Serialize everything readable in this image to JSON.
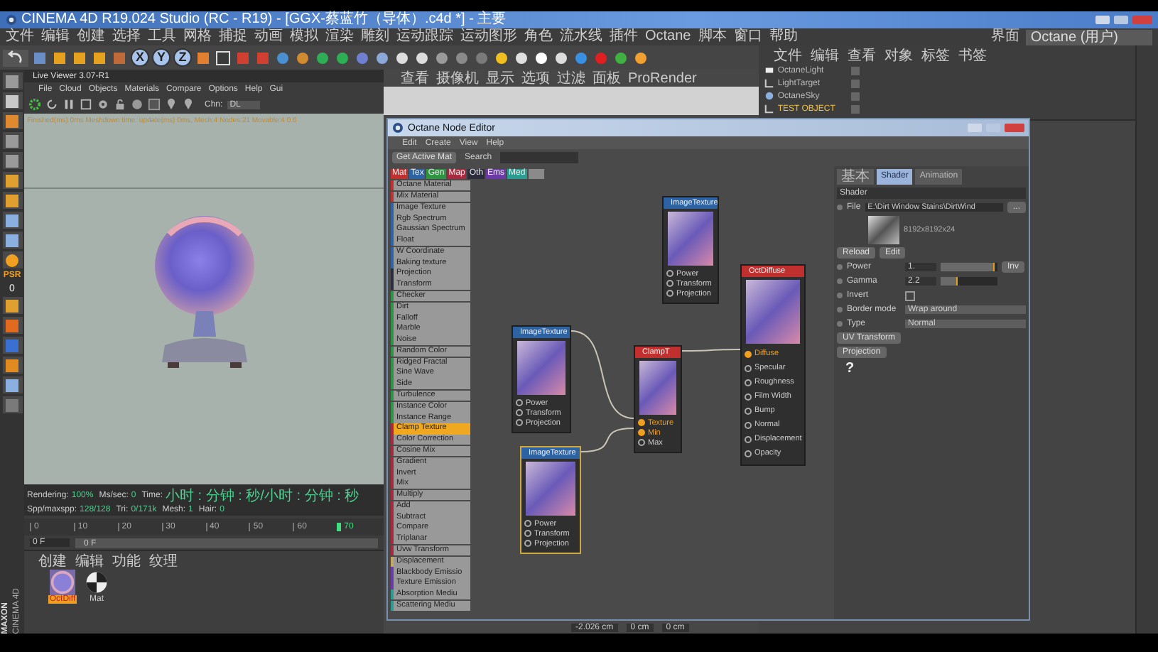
{
  "window": {
    "title": "CINEMA 4D R19.024 Studio (RC - R19) - [GGX-蔡蓝竹（导体）.c4d *] - 主要",
    "menus": [
      "文件",
      "编辑",
      "创建",
      "选择",
      "工具",
      "网格",
      "捕捉",
      "动画",
      "模拟",
      "渲染",
      "雕刻",
      "运动跟踪",
      "运动图形",
      "角色",
      "流水线",
      "插件",
      "Octane",
      "脚本",
      "窗口",
      "帮助"
    ],
    "layout_label": "界面",
    "layout_value": "Octane (用户)"
  },
  "toolbar": {
    "axis_buttons": [
      {
        "label": "X",
        "selected": true
      },
      {
        "label": "Y",
        "selected": true
      },
      {
        "label": "Z",
        "selected": true
      }
    ]
  },
  "left_toolbar": {
    "psr_label": "PSR",
    "psr_value": "0"
  },
  "live_viewer": {
    "title": "Live Viewer 3.07-R1",
    "menus": [
      "File",
      "Cloud",
      "Objects",
      "Materials",
      "Compare",
      "Options",
      "Help",
      "Gui"
    ],
    "chn_label": "Chn:",
    "chn_value": "DL",
    "status_text": "Finished(ms) 0ms Meshdown time: update(ms) 0ms, Mesh:4 Nodes:21 Movable:4 0.0",
    "stats": [
      {
        "label": "Rendering:",
        "value": "100%"
      },
      {
        "label": "Ms/sec:",
        "value": "0"
      },
      {
        "label": "Time:",
        "value": "小时 : 分钟 : 秒/小时 : 分钟 : 秒"
      },
      {
        "label": "Spp/maxspp:",
        "value": "128/128"
      },
      {
        "label": "Tri:",
        "value": "0/171k"
      },
      {
        "label": "Mesh:",
        "value": "1"
      },
      {
        "label": "Hair:",
        "value": "0"
      }
    ]
  },
  "timeline": {
    "ticks": [
      {
        "label": "0",
        "current": false
      },
      {
        "label": "10",
        "current": false
      },
      {
        "label": "20",
        "current": false
      },
      {
        "label": "30",
        "current": false
      },
      {
        "label": "40",
        "current": false
      },
      {
        "label": "50",
        "current": false
      },
      {
        "label": "60",
        "current": false
      },
      {
        "label": "70",
        "current": true
      }
    ],
    "frame_value": "0 F",
    "range": {
      "start": "0 F",
      "level": 1
    }
  },
  "material_manager": {
    "menus": [
      "创建",
      "编辑",
      "功能",
      "纹理"
    ],
    "materials": [
      {
        "name": "OctDiff",
        "kind": "texture",
        "selected": true
      },
      {
        "name": "Mat",
        "kind": "checker",
        "selected": false
      }
    ]
  },
  "brand": {
    "maxon": "MAXON",
    "product": "CINEMA 4D"
  },
  "viewport": {
    "menus": [
      "查看",
      "摄像机",
      "显示",
      "选项",
      "过滤",
      "面板",
      "ProRender"
    ],
    "coordinates": [
      "-2.026 cm",
      "0 cm",
      "0 cm"
    ]
  },
  "object_manager": {
    "menus": [
      "文件",
      "编辑",
      "查看",
      "对象",
      "标签",
      "书签"
    ],
    "objects": [
      {
        "name": "OctaneLight",
        "kind": "light",
        "selected": false
      },
      {
        "name": "LightTarget",
        "kind": "target",
        "selected": false
      },
      {
        "name": "OctaneSky",
        "kind": "sky",
        "selected": false
      },
      {
        "name": "TEST OBJECT",
        "kind": "target",
        "selected": true
      }
    ]
  },
  "node_editor": {
    "title": "Octane Node Editor",
    "menus": [
      "Edit",
      "Create",
      "View",
      "Help"
    ],
    "get_active_button": "Get Active Mat",
    "search_label": "Search",
    "categories": [
      {
        "label": "Mat",
        "color": "#c0302f"
      },
      {
        "label": "Tex",
        "color": "#2d63a3"
      },
      {
        "label": "Gen",
        "color": "#2f9442"
      },
      {
        "label": "Map",
        "color": "#a8283e"
      },
      {
        "label": "Oth",
        "color": "#2b2d3d"
      },
      {
        "label": "Ems",
        "color": "#6b3aa6"
      },
      {
        "label": "Med",
        "color": "#2a9c92"
      }
    ],
    "node_list": [
      {
        "name": "Octane Material",
        "color": "#c0302f",
        "selected": false
      },
      {
        "name": "Mix Material",
        "color": "#c0302f",
        "selected": false
      },
      {
        "name": "Image Texture",
        "color": "#2d63a3",
        "selected": false
      },
      {
        "name": "Rgb Spectrum",
        "color": "#2d63a3",
        "selected": false
      },
      {
        "name": "Gaussian Spectrum",
        "color": "#2d63a3",
        "selected": false
      },
      {
        "name": "Float",
        "color": "#2d63a3",
        "selected": false
      },
      {
        "name": "W Coordinate",
        "color": "#2d63a3",
        "selected": false
      },
      {
        "name": "Baking texture",
        "color": "#2d63a3",
        "selected": false
      },
      {
        "name": "Projection",
        "color": "#2b2d3d",
        "selected": false
      },
      {
        "name": "Transform",
        "color": "#2b2d3d",
        "selected": false
      },
      {
        "name": "Checker",
        "color": "#2f9442",
        "selected": false
      },
      {
        "name": "Dirt",
        "color": "#2f9442",
        "selected": false
      },
      {
        "name": "Falloff",
        "color": "#2f9442",
        "selected": false
      },
      {
        "name": "Marble",
        "color": "#2f9442",
        "selected": false
      },
      {
        "name": "Noise",
        "color": "#2f9442",
        "selected": false
      },
      {
        "name": "Random Color",
        "color": "#2f9442",
        "selected": false
      },
      {
        "name": "Ridged Fractal",
        "color": "#2f9442",
        "selected": false
      },
      {
        "name": "Sine Wave",
        "color": "#2f9442",
        "selected": false
      },
      {
        "name": "Side",
        "color": "#2f9442",
        "selected": false
      },
      {
        "name": "Turbulence",
        "color": "#2f9442",
        "selected": false
      },
      {
        "name": "Instance Color",
        "color": "#2f9442",
        "selected": false
      },
      {
        "name": "Instance Range",
        "color": "#2f9442",
        "selected": false
      },
      {
        "name": "Clamp Texture",
        "color": "#a8283e",
        "selected": true
      },
      {
        "name": "Color Correction",
        "color": "#a8283e",
        "selected": false
      },
      {
        "name": "Cosine Mix",
        "color": "#a8283e",
        "selected": false
      },
      {
        "name": "Gradient",
        "color": "#a8283e",
        "selected": false
      },
      {
        "name": "Invert",
        "color": "#a8283e",
        "selected": false
      },
      {
        "name": "Mix",
        "color": "#a8283e",
        "selected": false
      },
      {
        "name": "Multiply",
        "color": "#a8283e",
        "selected": false
      },
      {
        "name": "Add",
        "color": "#a8283e",
        "selected": false
      },
      {
        "name": "Subtract",
        "color": "#a8283e",
        "selected": false
      },
      {
        "name": "Compare",
        "color": "#a8283e",
        "selected": false
      },
      {
        "name": "Triplanar",
        "color": "#a8283e",
        "selected": false
      },
      {
        "name": "Uvw Transform",
        "color": "#a8283e",
        "selected": false
      },
      {
        "name": "Displacement",
        "color": "#c8a860",
        "selected": false
      },
      {
        "name": "Blackbody Emissio",
        "color": "#6b3aa6",
        "selected": false
      },
      {
        "name": "Texture Emission",
        "color": "#6b3aa6",
        "selected": false
      },
      {
        "name": "Absorption Mediu",
        "color": "#2a9c92",
        "selected": false
      },
      {
        "name": "Scattering Mediu",
        "color": "#2a9c92",
        "selected": false
      }
    ],
    "nodes": [
      {
        "title": "ImageTexture",
        "kind": "texture",
        "color": "#2d63a3",
        "selected": false,
        "ports": [
          {
            "name": "Power",
            "connected": false
          },
          {
            "name": "Transform",
            "connected": false
          },
          {
            "name": "Projection",
            "connected": false
          }
        ]
      },
      {
        "title": "OctDiffuse",
        "kind": "material",
        "color": "#c0302f",
        "selected": false,
        "ports": [
          {
            "name": "Diffuse",
            "connected": true
          },
          {
            "name": "Specular",
            "connected": false
          },
          {
            "name": "Roughness",
            "connected": false
          },
          {
            "name": "Film Width",
            "connected": false
          },
          {
            "name": "Bump",
            "connected": false
          },
          {
            "name": "Normal",
            "connected": false
          },
          {
            "name": "Displacement",
            "connected": false
          },
          {
            "name": "Opacity",
            "connected": false
          }
        ]
      },
      {
        "title": "ImageTexture",
        "kind": "texture",
        "color": "#2d63a3",
        "selected": false,
        "ports": [
          {
            "name": "Power",
            "connected": false
          },
          {
            "name": "Transform",
            "connected": false
          },
          {
            "name": "Projection",
            "connected": false
          }
        ]
      },
      {
        "title": "ClampT",
        "kind": "texture",
        "color": "#c0302f",
        "selected": false,
        "ports": [
          {
            "name": "Texture",
            "connected": true
          },
          {
            "name": "Min",
            "connected": true
          },
          {
            "name": "Max",
            "connected": false
          }
        ]
      },
      {
        "title": "ImageTexture",
        "kind": "texture",
        "color": "#2d63a3",
        "selected": true,
        "ports": [
          {
            "name": "Power",
            "connected": false
          },
          {
            "name": "Transform",
            "connected": false
          },
          {
            "name": "Projection",
            "connected": false
          }
        ]
      }
    ],
    "attributes": {
      "tabs": [
        {
          "label": "基本",
          "selected": false
        },
        {
          "label": "Shader",
          "selected": true
        },
        {
          "label": "Animation",
          "selected": false
        }
      ],
      "section": "Shader",
      "file_label": "File",
      "file_value": "E:\\Dirt Window Stains\\DirtWind",
      "browse": "...",
      "image_info": "8192x8192x24",
      "buttons": [
        "Reload",
        "Edit"
      ],
      "params": [
        {
          "kind": "slider",
          "label": "Power",
          "value": "1.",
          "level": 0.95,
          "button": "Inv"
        },
        {
          "kind": "slider",
          "label": "Gamma",
          "value": "2.2",
          "level": 0.3
        },
        {
          "kind": "checkbox",
          "label": "Invert",
          "checked": false
        },
        {
          "kind": "dropdown",
          "label": "Border mode",
          "value": "Wrap around"
        },
        {
          "kind": "dropdown",
          "label": "Type",
          "value": "Normal"
        }
      ],
      "sub_buttons": [
        "UV Transform",
        "Projection"
      ],
      "help": "?"
    }
  }
}
